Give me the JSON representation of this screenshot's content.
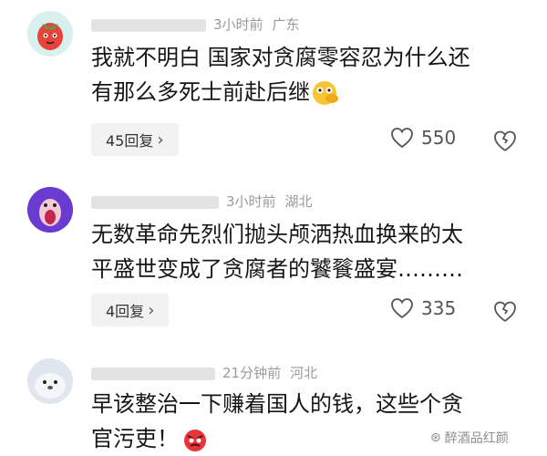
{
  "comments": [
    {
      "time": "3小时前",
      "location": "广东",
      "line1": "我就不明白 国家对贪腐零容忍为什么还",
      "line2": "有那么多死士前赴后继",
      "emoji": "thinking-emoji",
      "replies": "45回复",
      "likes": "550"
    },
    {
      "time": "3小时前",
      "location": "湖北",
      "line1": "无数革命先烈们抛头颅洒热血换来的太",
      "line2": "平盛世变成了贪腐者的饕餮盛宴………",
      "replies": "4回复",
      "likes": "335"
    },
    {
      "time": "21分钟前",
      "location": "河北",
      "line1": "早该整治一下赚着国人的钱，这些个贪",
      "line2": "官污吏！",
      "emoji": "angry-emoji"
    }
  ],
  "watermark": "醉酒品红颜",
  "colors": {
    "meta": "#9a9a9a",
    "text": "#161616",
    "reply_bg": "#f2f2f2"
  }
}
